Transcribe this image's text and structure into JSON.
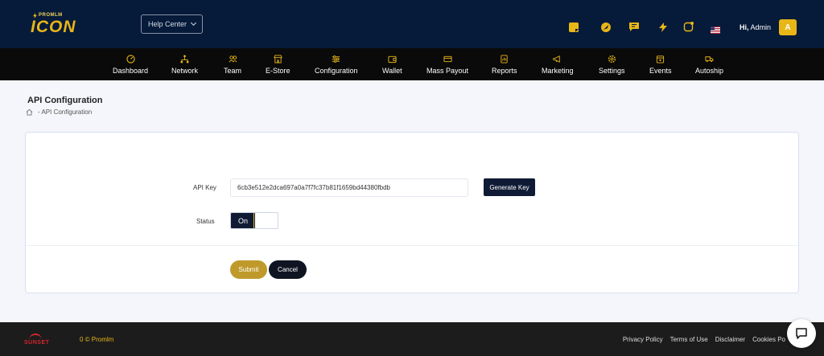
{
  "brand": {
    "small_text": "PROMLM",
    "big_text": "ICON"
  },
  "header": {
    "help_center_label": "Help Center",
    "greeting_prefix": "Hi,",
    "user_name": "Admin",
    "avatar_initial": "A",
    "icons": [
      "notes-icon",
      "rocket-icon",
      "message-icon",
      "bolt-icon",
      "notification-icon",
      "us-flag-icon"
    ],
    "accent_color": "#e8b617"
  },
  "nav": {
    "items": [
      {
        "label": "Dashboard",
        "icon": "dashboard-icon"
      },
      {
        "label": "Network",
        "icon": "network-icon"
      },
      {
        "label": "Team",
        "icon": "team-icon"
      },
      {
        "label": "E-Store",
        "icon": "store-icon"
      },
      {
        "label": "Configuration",
        "icon": "sliders-icon"
      },
      {
        "label": "Wallet",
        "icon": "wallet-icon"
      },
      {
        "label": "Mass Payout",
        "icon": "card-icon"
      },
      {
        "label": "Reports",
        "icon": "reports-icon"
      },
      {
        "label": "Marketing",
        "icon": "megaphone-icon"
      },
      {
        "label": "Settings",
        "icon": "gear-icon"
      },
      {
        "label": "Events",
        "icon": "calendar-icon"
      },
      {
        "label": "Autoship",
        "icon": "truck-icon"
      }
    ]
  },
  "page": {
    "title": "API Configuration",
    "breadcrumb_current": "- API Configuration"
  },
  "form": {
    "api_key_label": "API Key",
    "api_key_value": "6cb3e512e2dca697a0a7f7fc37b81f1659bd44380fbdb",
    "generate_key_label": "Generate Key",
    "status_label": "Status",
    "status_value": "On",
    "submit_label": "Submit",
    "cancel_label": "Cancel"
  },
  "footer": {
    "logo_text": "SUNSET",
    "copyright": "0 © Promlm",
    "links": [
      "Privacy Policy",
      "Terms of Use",
      "Disclaimer",
      "Cookies Po"
    ]
  }
}
